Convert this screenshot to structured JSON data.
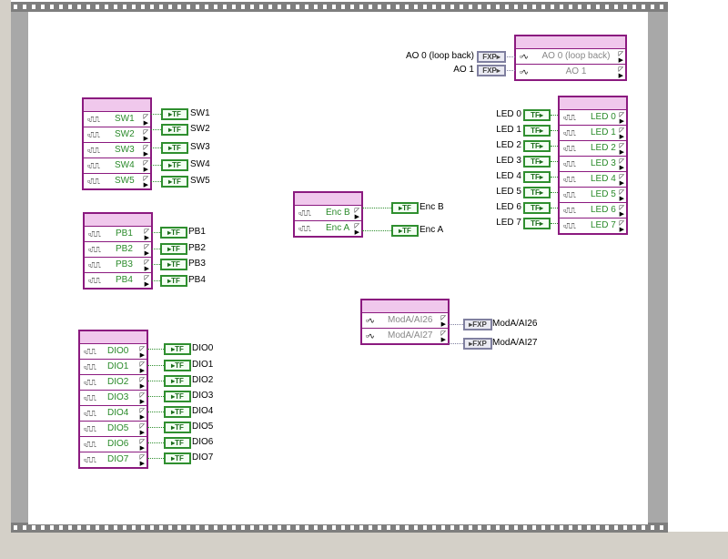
{
  "switch_node": {
    "items": [
      "SW1",
      "SW2",
      "SW3",
      "SW4",
      "SW5"
    ]
  },
  "switch_indicators": [
    "SW1",
    "SW2",
    "SW3",
    "SW4",
    "SW5"
  ],
  "pb_node": {
    "items": [
      "PB1",
      "PB2",
      "PB3",
      "PB4"
    ]
  },
  "pb_indicators": [
    "PB1",
    "PB2",
    "PB3",
    "PB4"
  ],
  "dio_node": {
    "items": [
      "DIO0",
      "DIO1",
      "DIO2",
      "DIO3",
      "DIO4",
      "DIO5",
      "DIO6",
      "DIO7"
    ]
  },
  "dio_indicators": [
    "DIO0",
    "DIO1",
    "DIO2",
    "DIO3",
    "DIO4",
    "DIO5",
    "DIO6",
    "DIO7"
  ],
  "enc_node": {
    "items": [
      "Enc B",
      "Enc A"
    ]
  },
  "enc_indicators": [
    "Enc B",
    "Enc A"
  ],
  "ao_node": {
    "items": [
      "AO 0 (loop back)",
      "AO 1"
    ]
  },
  "ao_controls": [
    "AO 0 (loop back)",
    "AO 1"
  ],
  "led_node": {
    "items": [
      "LED 0",
      "LED 1",
      "LED 2",
      "LED 3",
      "LED 4",
      "LED 5",
      "LED 6",
      "LED 7"
    ]
  },
  "led_controls": [
    "LED 0",
    "LED 1",
    "LED 2",
    "LED 3",
    "LED 4",
    "LED 5",
    "LED 6",
    "LED 7"
  ],
  "ai_node": {
    "items": [
      "ModA/AI26",
      "ModA/AI27"
    ]
  },
  "ai_indicators": [
    "ModA/AI26",
    "ModA/AI27"
  ],
  "terminal_types": {
    "boolean": "TF",
    "fixed_point": "FXP"
  },
  "colors": {
    "node_border": "#8b1a7f",
    "node_header": "#f0c8ec",
    "boolean_wire": "#2f8f2f",
    "fxp_wire": "#8080a0"
  }
}
